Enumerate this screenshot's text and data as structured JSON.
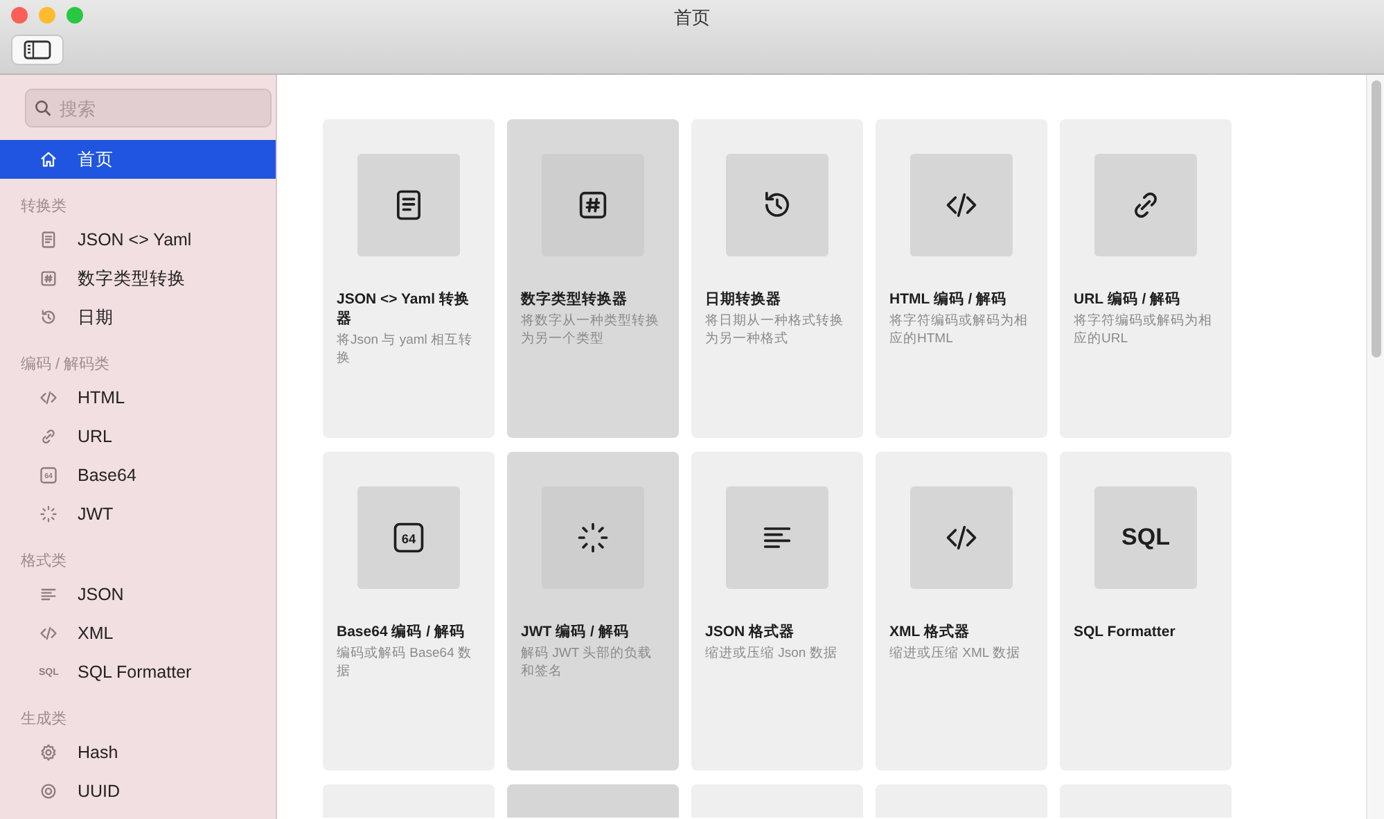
{
  "window": {
    "title": "首页"
  },
  "sidebar": {
    "search": {
      "placeholder": "搜索"
    },
    "home": {
      "label": "首页",
      "kind": "home",
      "selected": true
    },
    "sections": [
      {
        "title": "转换类",
        "items": [
          {
            "label": "JSON <> Yaml",
            "kind": "doc",
            "selected": false
          },
          {
            "label": "数字类型转换",
            "kind": "hash",
            "selected": false
          },
          {
            "label": "日期",
            "kind": "clock",
            "selected": false
          }
        ]
      },
      {
        "title": "编码 / 解码类",
        "items": [
          {
            "label": "HTML",
            "kind": "code",
            "selected": false
          },
          {
            "label": "URL",
            "kind": "link",
            "selected": false
          },
          {
            "label": "Base64",
            "kind": "b64",
            "icon_text": "64",
            "selected": false
          },
          {
            "label": "JWT",
            "kind": "spinner",
            "selected": false
          }
        ]
      },
      {
        "title": "格式类",
        "items": [
          {
            "label": "JSON",
            "kind": "lines",
            "selected": false
          },
          {
            "label": "XML",
            "kind": "code",
            "selected": false
          },
          {
            "label": "SQL Formatter",
            "kind": "sql",
            "icon_text": "SQL",
            "selected": false
          }
        ]
      },
      {
        "title": "生成类",
        "items": [
          {
            "label": "Hash",
            "kind": "gear",
            "selected": false
          },
          {
            "label": "UUID",
            "kind": "target",
            "selected": false
          }
        ]
      }
    ]
  },
  "cards": [
    {
      "title": "JSON <> Yaml 转换器",
      "description": "将Json 与 yaml 相互转换",
      "kind": "doc",
      "highlighted": false
    },
    {
      "title": "数字类型转换器",
      "description": "将数字从一种类型转换为另一个类型",
      "kind": "hash",
      "highlighted": true
    },
    {
      "title": "日期转换器",
      "description": "将日期从一种格式转换为另一种格式",
      "kind": "clock",
      "highlighted": false
    },
    {
      "title": "HTML 编码 / 解码",
      "description": "将字符编码或解码为相应的HTML",
      "kind": "code",
      "highlighted": false
    },
    {
      "title": "URL 编码 / 解码",
      "description": "将字符编码或解码为相应的URL",
      "kind": "link",
      "highlighted": false
    },
    {
      "title": "Base64 编码 / 解码",
      "description": "编码或解码 Base64 数据",
      "kind": "b64",
      "icon_text": "64",
      "highlighted": false
    },
    {
      "title": "JWT 编码 / 解码",
      "description": "解码 JWT 头部的负载和签名",
      "kind": "spinner",
      "highlighted": true
    },
    {
      "title": "JSON 格式器",
      "description": "缩进或压缩 Json 数据",
      "kind": "lines",
      "highlighted": false
    },
    {
      "title": "XML 格式器",
      "description": "缩进或压缩 XML 数据",
      "kind": "code",
      "highlighted": false
    },
    {
      "title": "SQL Formatter",
      "kind": "sql",
      "icon_text": "SQL",
      "highlighted": false
    },
    {
      "kind": "empty",
      "highlighted": false
    },
    {
      "kind": "empty",
      "highlighted": true
    },
    {
      "kind": "empty",
      "highlighted": false
    },
    {
      "kind": "empty",
      "highlighted": false
    },
    {
      "kind": "empty",
      "highlighted": false
    }
  ]
}
